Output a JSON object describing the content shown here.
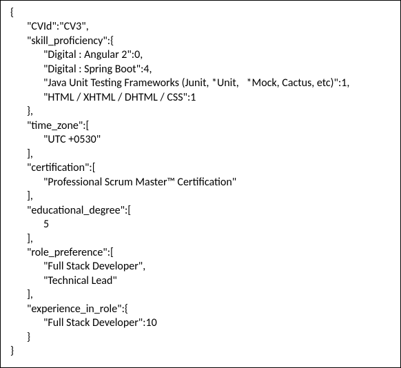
{
  "code": {
    "l0": "{",
    "l1": "\"CVId\":\"CV3\",",
    "l2": "\"skill_proficiency\":{",
    "l3": "\"Digital : Angular 2\":0,",
    "l4": "\"Digital : Spring Boot\":4,",
    "l5": "\"Java Unit Testing Frameworks (Junit, *Unit,   *Mock, Cactus, etc)\":1,",
    "l6": "\"HTML / XHTML / DHTML / CSS\":1",
    "l7": "},",
    "l8": "\"time_zone\":[",
    "l9": "\"UTC +0530\"",
    "l10": "],",
    "l11": "\"certification\":[",
    "l12": "\"Professional Scrum Master™ Certification\"",
    "l13": "],",
    "l14": "\"educational_degree\":[",
    "l15": "5",
    "l16": "],",
    "l17": "\"role_preference\":[",
    "l18": "\"Full Stack Developer\",",
    "l19": "\"Technical Lead\"",
    "l20": "],",
    "l21": "\"experience_in_role\":{",
    "l22": "\"Full Stack Developer\":10",
    "l23": "}",
    "l24": "}"
  }
}
